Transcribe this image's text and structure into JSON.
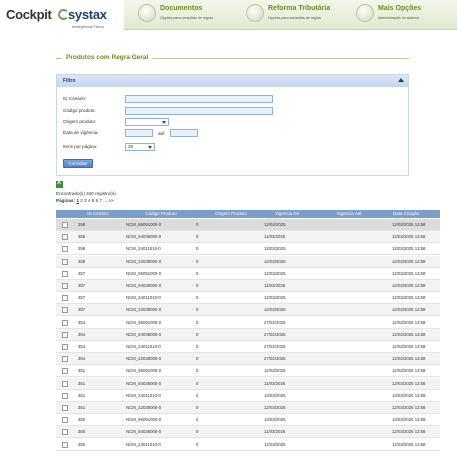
{
  "logo": {
    "cockpit": "Cockpit",
    "systax": "systax",
    "tagline": "Inteligência Fiscal"
  },
  "tabs": [
    {
      "title": "Documentos",
      "subtitle": "Opções para consultas de regras"
    },
    {
      "title": "Reforma Tributária",
      "subtitle": "Opções para consultas de regras"
    },
    {
      "title": "Mais Opções",
      "subtitle": "Administração do sistema"
    }
  ],
  "panel": {
    "title": "Produtos com Regra Geral"
  },
  "filter": {
    "header": "Filtro",
    "id_cenario_label": "ID Cenário:",
    "id_cenario_value": "",
    "codigo_label": "Código produto:",
    "codigo_value": "",
    "origem_label": "Origem produto:",
    "origem_value": "",
    "data_label": "Data de vigência:",
    "data_from": "",
    "data_ate_label": "até",
    "data_to": "",
    "itens_label": "Itens por página:",
    "itens_value": "25",
    "consultar": "Consultar"
  },
  "results": {
    "found": "Encontrado(s) 340 registro(s).",
    "pages_label": "Páginas:",
    "current_page": "1",
    "other_pages": "2 3 4 5 6 7 ... >>"
  },
  "table": {
    "headers": [
      "ID Cenário",
      "Código Produto",
      "Origem Produto",
      "Vigencia De",
      "Vigencia Até",
      "Data Criação"
    ],
    "rows": [
      [
        "358",
        "NCM_96091000-0",
        "0",
        "12/03/2025",
        "",
        "12/03/2025 13:58"
      ],
      [
        "358",
        "NCM_94036000-0",
        "0",
        "11/03/2025",
        "",
        "12/03/2025 13:58"
      ],
      [
        "358",
        "NCM_24011010-0",
        "0",
        "12/03/2025",
        "",
        "12/03/2025 13:58"
      ],
      [
        "358",
        "NCM_22030000-0",
        "0",
        "12/03/2025",
        "",
        "12/03/2025 13:58"
      ],
      [
        "357",
        "NCM_96091000-0",
        "0",
        "12/03/2025",
        "",
        "12/03/2025 13:58"
      ],
      [
        "357",
        "NCM_94036000-0",
        "0",
        "11/03/2025",
        "",
        "12/03/2025 13:58"
      ],
      [
        "357",
        "NCM_24011010-0",
        "0",
        "12/03/2025",
        "",
        "12/03/2025 13:58"
      ],
      [
        "357",
        "NCM_22030000-0",
        "0",
        "12/03/2025",
        "",
        "12/03/2025 13:58"
      ],
      [
        "354",
        "NCM_96091000-0",
        "0",
        "27/02/2025",
        "",
        "12/03/2025 13:58"
      ],
      [
        "354",
        "NCM_94036000-0",
        "0",
        "27/02/2025",
        "",
        "12/03/2025 13:58"
      ],
      [
        "354",
        "NCM_24011010-0",
        "0",
        "27/02/2025",
        "",
        "12/03/2025 13:58"
      ],
      [
        "354",
        "NCM_22030000-0",
        "0",
        "27/02/2025",
        "",
        "12/03/2025 13:58"
      ],
      [
        "351",
        "NCM_96091000-0",
        "0",
        "12/03/2025",
        "",
        "12/03/2025 13:58"
      ],
      [
        "351",
        "NCM_94036000-0",
        "0",
        "11/03/2025",
        "",
        "12/03/2025 13:58"
      ],
      [
        "351",
        "NCM_24011010-0",
        "0",
        "12/03/2025",
        "",
        "12/03/2025 13:58"
      ],
      [
        "351",
        "NCM_22030000-0",
        "0",
        "12/03/2025",
        "",
        "12/03/2025 13:58"
      ],
      [
        "350",
        "NCM_96091000-0",
        "0",
        "12/03/2025",
        "",
        "12/03/2025 13:58"
      ],
      [
        "350",
        "NCM_94036000-0",
        "0",
        "11/03/2025",
        "",
        "12/03/2025 13:58"
      ],
      [
        "350",
        "NCM_24011010-0",
        "0",
        "12/03/2025",
        "",
        "12/03/2025 13:58"
      ]
    ]
  },
  "colors": {
    "accent_green": "#6b8e23",
    "table_header": "#7a9ec9",
    "brand_blue": "#1f3f74"
  }
}
